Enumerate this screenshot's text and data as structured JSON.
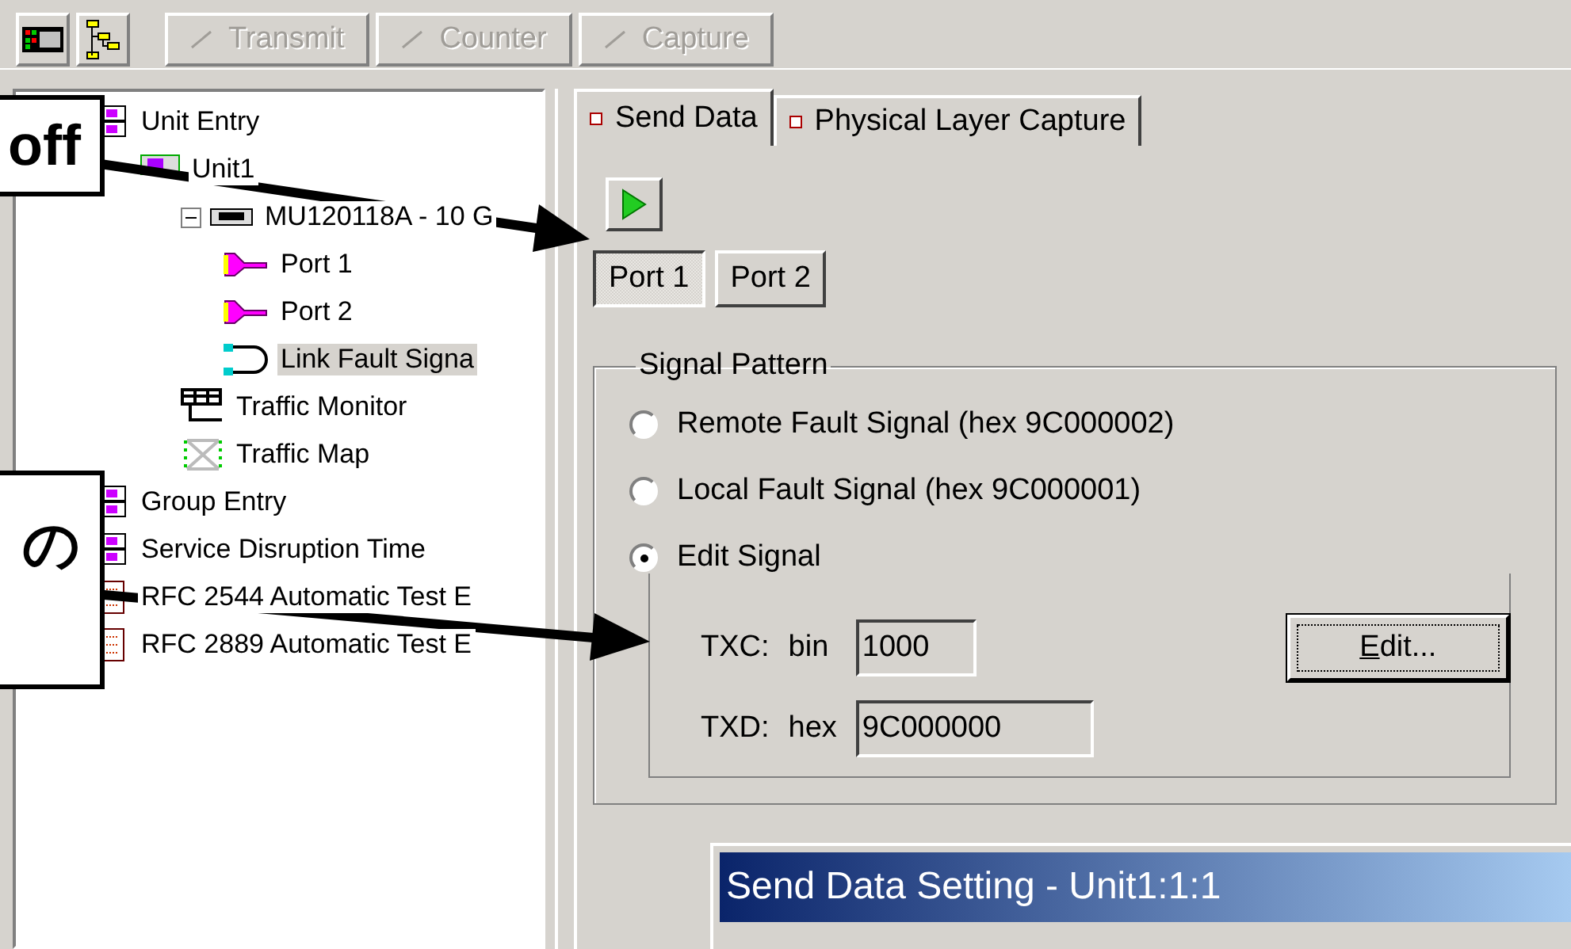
{
  "toolbar": {
    "icon_buttons": [
      {
        "kind": "grid"
      },
      {
        "kind": "tree"
      }
    ],
    "buttons": [
      {
        "label": "Transmit",
        "disabled": true
      },
      {
        "label": "Counter",
        "disabled": true
      },
      {
        "label": "Capture",
        "disabled": true
      }
    ]
  },
  "tree": [
    {
      "label": "Unit Entry",
      "kind": "unit",
      "selected": false,
      "children": [
        {
          "label": "Unit1",
          "kind": "module",
          "selected": false,
          "children": [
            {
              "label": "MU120118A - 10 G",
              "kind": "card",
              "expanded": true,
              "selected": false,
              "children": [
                {
                  "label": "Port 1",
                  "kind": "port",
                  "selected": false
                },
                {
                  "label": "Port 2",
                  "kind": "port",
                  "selected": false
                },
                {
                  "label": "Link Fault Signa",
                  "kind": "loop",
                  "selected": true
                }
              ]
            },
            {
              "label": "Traffic Monitor",
              "kind": "monitor",
              "selected": false
            },
            {
              "label": "Traffic Map",
              "kind": "map",
              "selected": false
            }
          ]
        }
      ]
    },
    {
      "label": "Group Entry",
      "kind": "unit",
      "selected": false
    },
    {
      "label": "Service Disruption Time",
      "kind": "unit",
      "selected": false
    },
    {
      "label": "RFC 2544 Automatic Test E",
      "kind": "rfc",
      "selected": false
    },
    {
      "label": "RFC 2889 Automatic Test E",
      "kind": "rfc",
      "selected": false
    }
  ],
  "tabs": [
    {
      "label": "Send Data",
      "selected": true
    },
    {
      "label": "Physical Layer Capture",
      "selected": false
    }
  ],
  "ports": [
    {
      "label": "Port 1",
      "selected": true
    },
    {
      "label": "Port 2",
      "selected": false
    }
  ],
  "signal_pattern": {
    "title": "Signal Pattern",
    "options": [
      {
        "label": "Remote Fault Signal (hex 9C000002)",
        "selected": false
      },
      {
        "label": "Local Fault Signal (hex 9C000001)",
        "selected": false
      },
      {
        "label": "Edit Signal",
        "selected": true
      }
    ],
    "txc": {
      "label": "TXC:",
      "unit": "bin",
      "value": "1000"
    },
    "txd": {
      "label": "TXD:",
      "unit": "hex",
      "value": "9C000000"
    },
    "edit_button": "Edit..."
  },
  "dialog": {
    "title": "Send Data Setting - Unit1:1:1"
  },
  "callouts": [
    {
      "text": "off"
    },
    {
      "text": "の"
    }
  ]
}
